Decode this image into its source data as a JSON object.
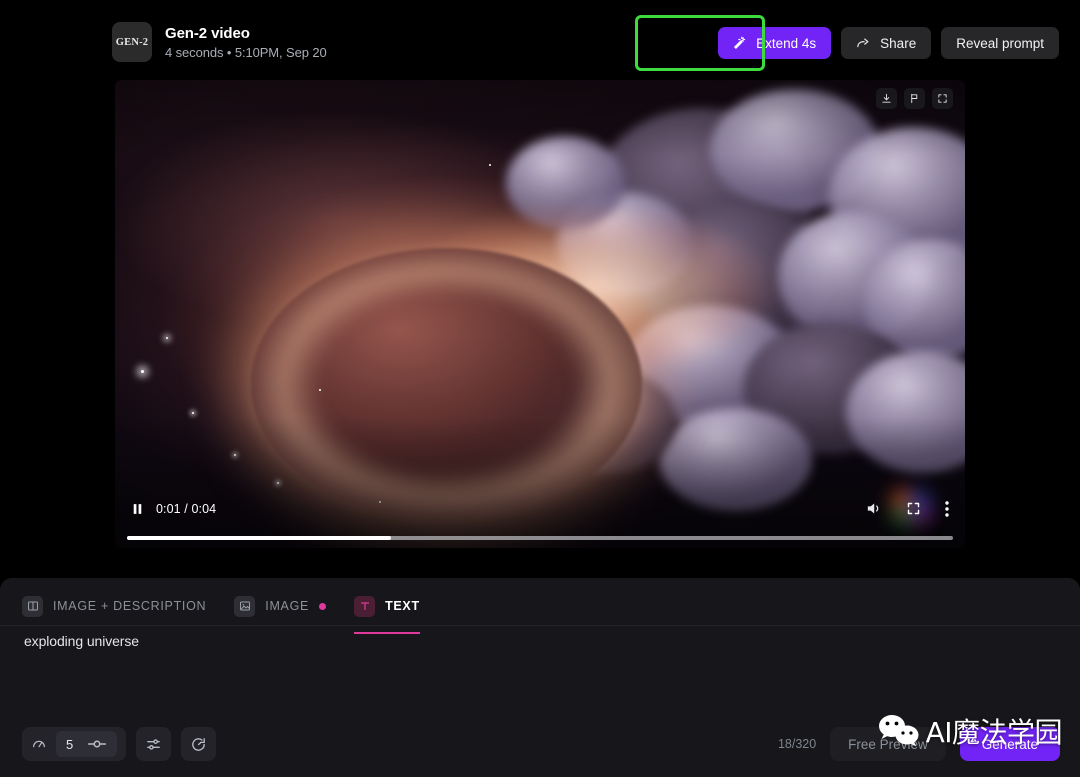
{
  "header": {
    "thumb_label": "GEN-2",
    "title": "Gen-2 video",
    "subtitle": "4 seconds • 5:10PM, Sep 20",
    "actions": {
      "extend_label": "Extend 4s",
      "share_label": "Share",
      "reveal_label": "Reveal prompt"
    },
    "highlight_color": "#3ddb3d",
    "primary_color": "#7124f5"
  },
  "video": {
    "overlay_icons": [
      "download-icon",
      "flag-icon",
      "expand-icon"
    ],
    "current_time": "0:01",
    "total_time": "0:04",
    "time_display": "0:01 / 0:04",
    "progress_percent": 32,
    "play_state": "paused",
    "controls": [
      "pause-button",
      "volume-icon",
      "fullscreen-icon",
      "more-options-icon"
    ]
  },
  "panel": {
    "tabs": [
      {
        "label": "IMAGE + DESCRIPTION",
        "icon": "split-panel-icon",
        "active": false,
        "dot": false
      },
      {
        "label": "IMAGE",
        "icon": "image-icon",
        "active": false,
        "dot": true
      },
      {
        "label": "TEXT",
        "icon": "text-icon",
        "active": true,
        "dot": false
      }
    ],
    "accent_color": "#e0399b",
    "prompt_text": "exploding universe",
    "toolbar": [
      {
        "name": "guidance-icon",
        "type": "icon"
      },
      {
        "name": "seed-stepper",
        "type": "combo",
        "value": "5"
      },
      {
        "name": "settings-sliders-icon",
        "type": "icon"
      },
      {
        "name": "timer-icon",
        "type": "icon"
      }
    ],
    "counter": "18/320",
    "preview_label": "Free Preview",
    "generate_label": "Generate"
  },
  "watermark": {
    "logo": "wechat-icon",
    "text": "AI魔法学园"
  }
}
